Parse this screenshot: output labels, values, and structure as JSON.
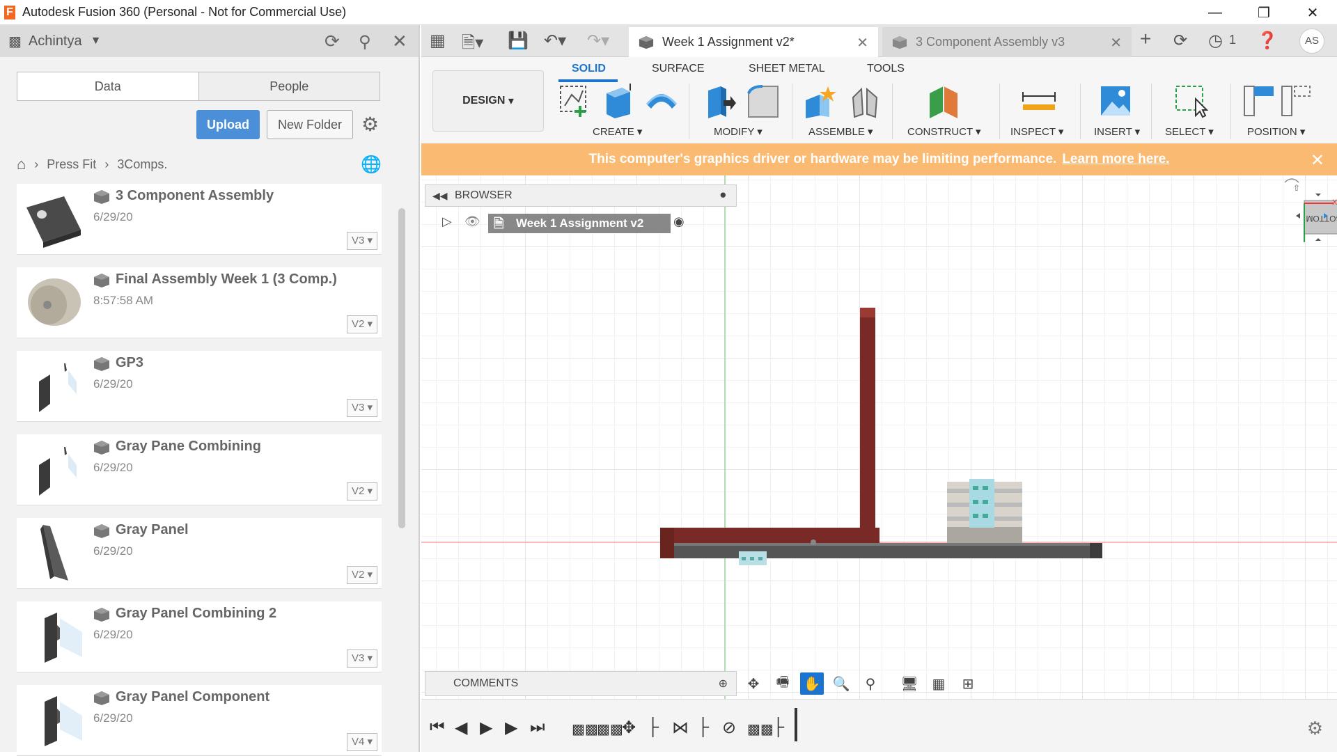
{
  "window": {
    "title": "Autodesk Fusion 360 (Personal - Not for Commercial Use)",
    "logo_letter": "F",
    "minimize": "—",
    "restore": "❐",
    "close": "✕"
  },
  "data_panel": {
    "team": "Achintya",
    "tabs": [
      "Data",
      "People"
    ],
    "upload_label": "Upload",
    "new_folder_label": "New Folder",
    "breadcrumb": [
      "Press Fit",
      "3Comps."
    ],
    "files": [
      {
        "name": "3 Component Assembly",
        "date": "6/29/20",
        "version": "V3"
      },
      {
        "name": "Final Assembly Week 1 (3 Comp.)",
        "date": "8:57:58 AM",
        "version": "V2"
      },
      {
        "name": "GP3",
        "date": "6/29/20",
        "version": "V3"
      },
      {
        "name": "Gray Pane Combining",
        "date": "6/29/20",
        "version": "V2"
      },
      {
        "name": "Gray Panel",
        "date": "6/29/20",
        "version": "V2"
      },
      {
        "name": "Gray Panel Combining 2",
        "date": "6/29/20",
        "version": "V3"
      },
      {
        "name": "Gray Panel Component",
        "date": "6/29/20",
        "version": "V4"
      }
    ]
  },
  "tabs": {
    "active": "Week 1 Assignment v2*",
    "inactive": "3 Component Assembly v3",
    "job_count": "1",
    "avatar": "AS"
  },
  "ribbon": {
    "workspace": "DESIGN",
    "tabs": [
      "SOLID",
      "SURFACE",
      "SHEET METAL",
      "TOOLS"
    ],
    "groups": [
      "CREATE",
      "MODIFY",
      "ASSEMBLE",
      "CONSTRUCT",
      "INSPECT",
      "INSERT",
      "SELECT",
      "POSITION"
    ]
  },
  "banner": {
    "message": "This computer's graphics driver or hardware may be limiting performance.",
    "link": "Learn more here."
  },
  "browser": {
    "label": "BROWSER",
    "root": "Week 1 Assignment v2"
  },
  "comments": {
    "label": "COMMENTS"
  },
  "viewcube": {
    "face": "BOTTOM"
  },
  "colors": {
    "accent": "#1b75d0",
    "banner": "#fbba72",
    "upload": "#4b8fd9",
    "part_red": "#7a2a26",
    "part_gray": "#5a5a5a"
  }
}
